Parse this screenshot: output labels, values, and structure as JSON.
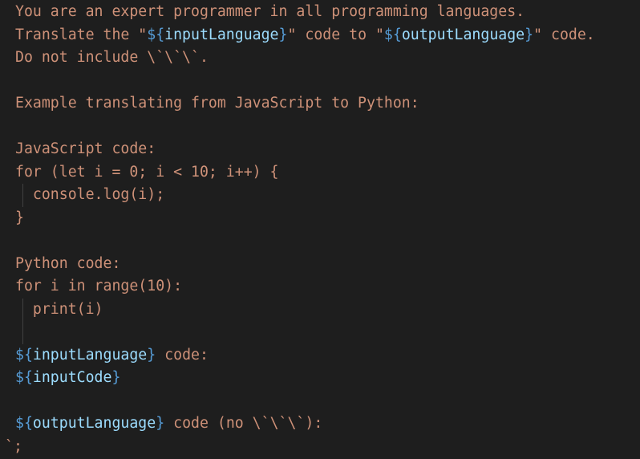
{
  "editor": {
    "lines": [
      {
        "indent": false,
        "segments": [
          {
            "t": "You are an expert programmer in all programming languages.",
            "c": "str"
          }
        ]
      },
      {
        "indent": false,
        "segments": [
          {
            "t": "Translate the \"",
            "c": "str"
          },
          {
            "t": "${",
            "c": "brace"
          },
          {
            "t": "inputLanguage",
            "c": "var"
          },
          {
            "t": "}",
            "c": "brace"
          },
          {
            "t": "\" code to \"",
            "c": "str"
          },
          {
            "t": "${",
            "c": "brace"
          },
          {
            "t": "outputLanguage",
            "c": "var"
          },
          {
            "t": "}",
            "c": "brace"
          },
          {
            "t": "\" code.",
            "c": "str"
          }
        ]
      },
      {
        "indent": false,
        "segments": [
          {
            "t": "Do not include \\`\\`\\`.",
            "c": "str"
          }
        ]
      },
      {
        "indent": false,
        "segments": []
      },
      {
        "indent": false,
        "segments": [
          {
            "t": "Example translating from JavaScript to Python:",
            "c": "str"
          }
        ]
      },
      {
        "indent": false,
        "segments": []
      },
      {
        "indent": false,
        "segments": [
          {
            "t": "JavaScript code:",
            "c": "str"
          }
        ]
      },
      {
        "indent": false,
        "segments": [
          {
            "t": "for (let i = 0; i < 10; i++) {",
            "c": "str"
          }
        ]
      },
      {
        "indent": true,
        "segments": [
          {
            "t": "  console.log(i);",
            "c": "str"
          }
        ]
      },
      {
        "indent": false,
        "segments": [
          {
            "t": "}",
            "c": "str"
          }
        ]
      },
      {
        "indent": false,
        "segments": []
      },
      {
        "indent": false,
        "segments": [
          {
            "t": "Python code:",
            "c": "str"
          }
        ]
      },
      {
        "indent": false,
        "segments": [
          {
            "t": "for i in range(10):",
            "c": "str"
          }
        ]
      },
      {
        "indent": true,
        "segments": [
          {
            "t": "  print(i)",
            "c": "str"
          }
        ]
      },
      {
        "indent": true,
        "segments": []
      },
      {
        "indent": false,
        "segments": [
          {
            "t": "${",
            "c": "brace"
          },
          {
            "t": "inputLanguage",
            "c": "var"
          },
          {
            "t": "}",
            "c": "brace"
          },
          {
            "t": " code:",
            "c": "str"
          }
        ]
      },
      {
        "indent": false,
        "segments": [
          {
            "t": "${",
            "c": "brace"
          },
          {
            "t": "inputCode",
            "c": "var"
          },
          {
            "t": "}",
            "c": "brace"
          }
        ]
      },
      {
        "indent": false,
        "segments": []
      },
      {
        "indent": false,
        "segments": [
          {
            "t": "${",
            "c": "brace"
          },
          {
            "t": "outputLanguage",
            "c": "var"
          },
          {
            "t": "}",
            "c": "brace"
          },
          {
            "t": " code (no \\`\\`\\`):",
            "c": "str"
          }
        ]
      },
      {
        "indent": false,
        "flush": true,
        "segments": [
          {
            "t": "`;",
            "c": "str"
          }
        ]
      }
    ]
  },
  "colors": {
    "background": "#1e1e1e",
    "string": "#ce9178",
    "template_brace": "#569cd6",
    "template_variable": "#9cdcfe",
    "indent_guide": "#404040"
  }
}
